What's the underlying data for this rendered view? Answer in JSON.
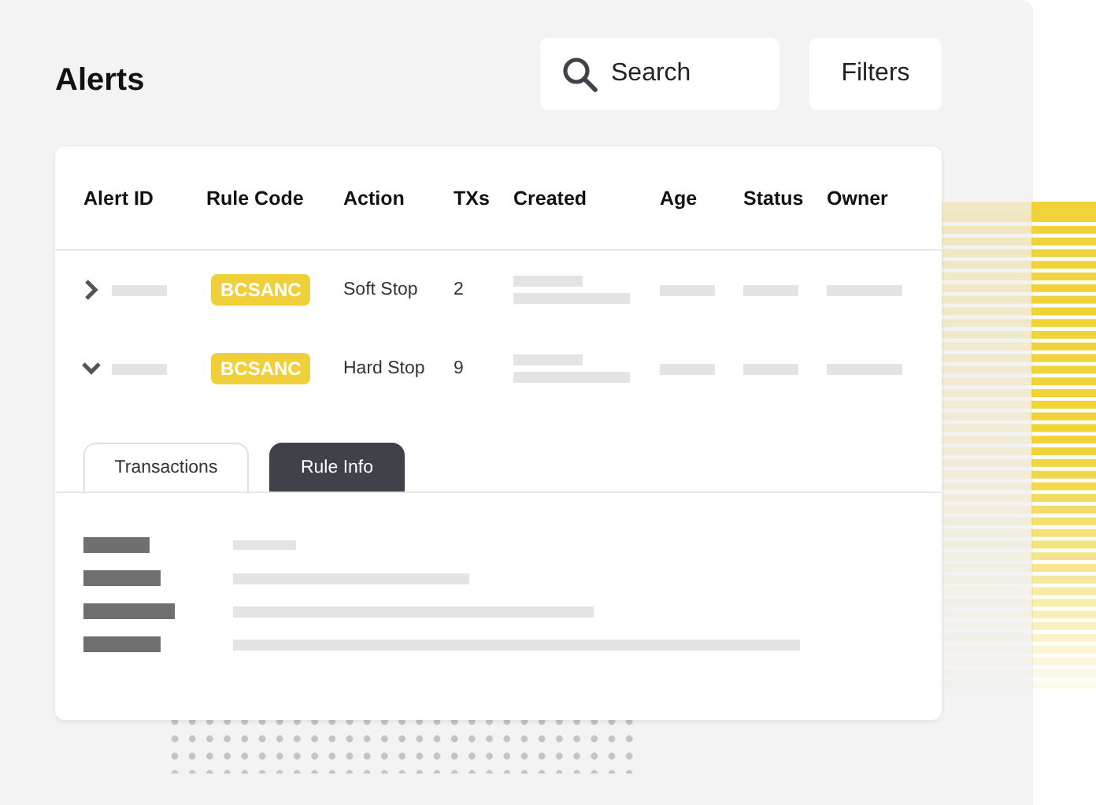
{
  "title": "Alerts",
  "search": {
    "placeholder": "Search"
  },
  "filters_button": "Filters",
  "table": {
    "columns": [
      "Alert ID",
      "Rule Code",
      "Action",
      "TXs",
      "Created",
      "Age",
      "Status",
      "Owner"
    ],
    "rows": [
      {
        "expanded": false,
        "rule_code": "BCSANC",
        "action": "Soft Stop",
        "txs": "2"
      },
      {
        "expanded": true,
        "rule_code": "BCSANC",
        "action": "Hard Stop",
        "txs": "9"
      }
    ]
  },
  "tabs": [
    {
      "label": "Transactions",
      "selected": false
    },
    {
      "label": "Rule Info",
      "selected": true
    }
  ]
}
